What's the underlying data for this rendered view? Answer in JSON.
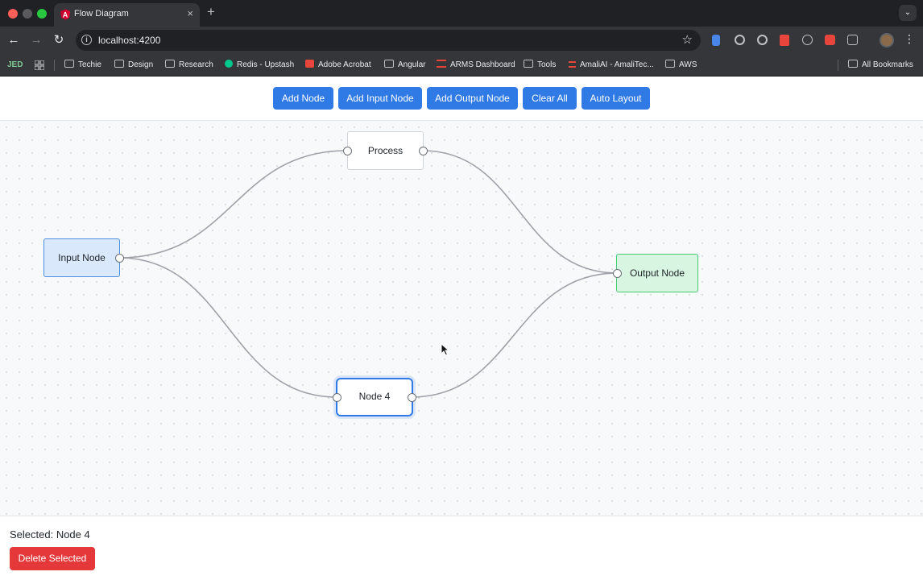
{
  "browser": {
    "tab_title": "Flow Diagram",
    "tab_close": "×",
    "new_tab": "+",
    "url": "localhost:4200",
    "bookmarks": {
      "jed": "JED",
      "items": [
        "Techie",
        "Design",
        "Research",
        "Redis - Upstash",
        "Adobe Acrobat",
        "Angular",
        "ARMS Dashboard",
        "Tools",
        "AmaliAI - AmaliTec...",
        "AWS"
      ],
      "all_bookmarks": "All Bookmarks"
    }
  },
  "toolbar": {
    "add_node": "Add Node",
    "add_input_node": "Add Input Node",
    "add_output_node": "Add Output Node",
    "clear_all": "Clear All",
    "auto_layout": "Auto Layout"
  },
  "canvas": {
    "nodes": {
      "input": "Input Node",
      "process": "Process",
      "output": "Output Node",
      "node4": "Node 4"
    }
  },
  "footer": {
    "selected": "Selected: Node 4",
    "delete_selected": "Delete Selected"
  },
  "colors": {
    "primary": "#2f7ae5",
    "danger": "#e5383b",
    "input_node": "#d9e9fb",
    "output_node": "#d7f5e1",
    "edge": "#9ea2a8"
  }
}
